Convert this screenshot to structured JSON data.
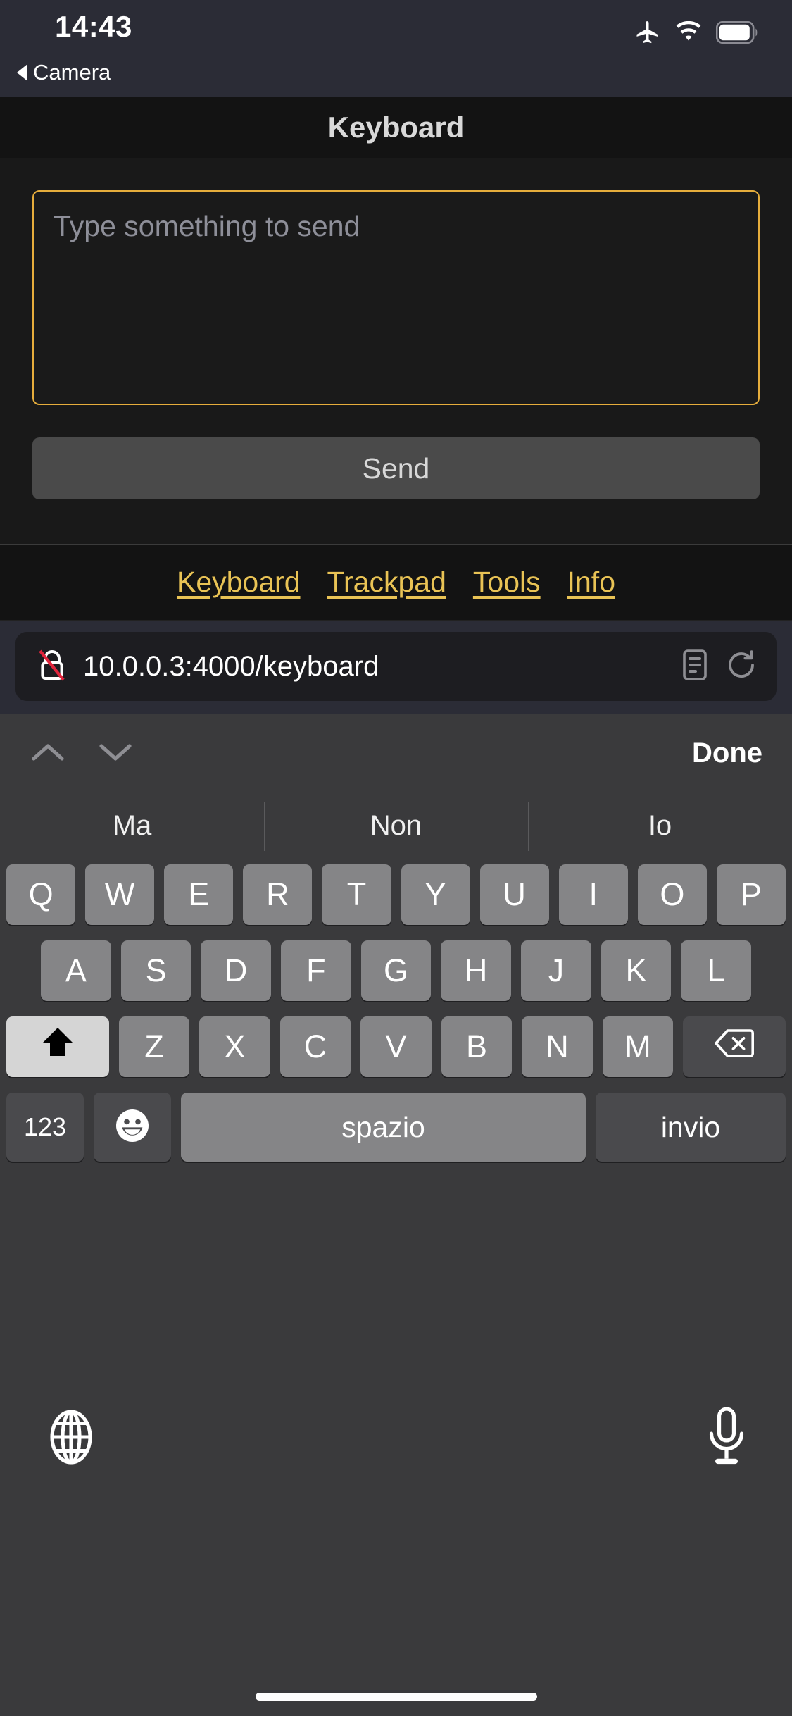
{
  "status_bar": {
    "time": "14:43",
    "back_app_label": "Camera",
    "icons": [
      "airplane-mode-icon",
      "wifi-icon",
      "battery-icon"
    ],
    "battery_level_percent": 85
  },
  "web_page": {
    "title": "Keyboard",
    "textarea": {
      "placeholder": "Type something to send",
      "value": "",
      "border_color": "#e6ad3c"
    },
    "send_button_label": "Send",
    "nav_links": [
      {
        "label": "Keyboard"
      },
      {
        "label": "Trackpad"
      },
      {
        "label": "Tools"
      },
      {
        "label": "Info"
      }
    ],
    "link_color": "#e9c355"
  },
  "browser": {
    "url": "10.0.0.3:4000/keyboard",
    "security_icon": "insecure-lock-icon",
    "reader_icon": "reader-view-icon",
    "reload_icon": "reload-icon"
  },
  "keyboard": {
    "accessory": {
      "prev_icon": "chevron-up-icon",
      "next_icon": "chevron-down-icon",
      "done_label": "Done"
    },
    "predictions": [
      "Ma",
      "Non",
      "Io"
    ],
    "rows": [
      [
        "Q",
        "W",
        "E",
        "R",
        "T",
        "Y",
        "U",
        "I",
        "O",
        "P"
      ],
      [
        "A",
        "S",
        "D",
        "F",
        "G",
        "H",
        "J",
        "K",
        "L"
      ],
      [
        "Z",
        "X",
        "C",
        "V",
        "B",
        "N",
        "M"
      ]
    ],
    "shift_icon": "shift-arrow-up-icon",
    "shift_active": true,
    "delete_icon": "delete-backward-icon",
    "numeric_label": "123",
    "emoji_icon": "smiley-face-icon",
    "space_label": "spazio",
    "return_label": "invio",
    "globe_icon": "globe-icon",
    "dictation_icon": "microphone-icon",
    "key_color": "#858587",
    "special_key_color": "#4a4a4d",
    "shift_active_color": "#d5d5d5",
    "background_color": "#3a3a3c"
  }
}
